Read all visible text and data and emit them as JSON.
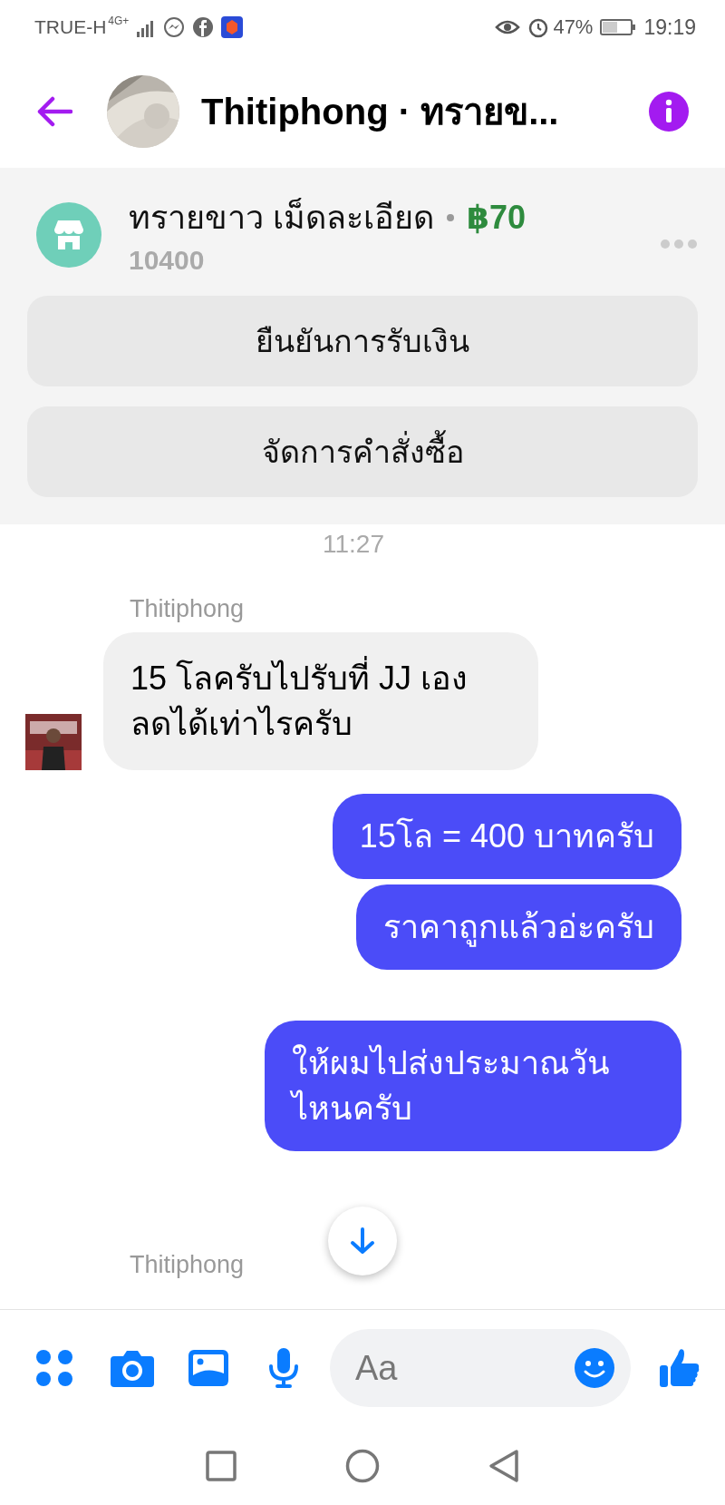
{
  "status_bar": {
    "carrier": "TRUE-H",
    "network": "4G+",
    "battery": "47%",
    "time": "19:19"
  },
  "header": {
    "title": "Thitiphong · ทรายข..."
  },
  "listing": {
    "title": "ทรายขาว เม็ดละเอียด",
    "price": "฿70",
    "code": "10400",
    "actions": [
      "ยืนยันการรับเงิน",
      "จัดการคำสั่งซื้อ"
    ]
  },
  "messages": [
    {
      "kind": "timestamp",
      "text": "11:27"
    },
    {
      "kind": "sender",
      "text": "Thitiphong"
    },
    {
      "kind": "incoming",
      "text": "15 โลครับไปรับที่ JJ เอง ลดได้เท่าไรครับ"
    },
    {
      "kind": "outgoing",
      "text": "15โล = 400 บาทครับ"
    },
    {
      "kind": "outgoing",
      "text": "ราคาถูกแล้วอ่ะครับ"
    },
    {
      "kind": "outgoing",
      "text": "ให้ผมไปส่งประมาณวันไหนครับ"
    },
    {
      "kind": "sender",
      "text": "Thitiphong"
    }
  ],
  "composer": {
    "placeholder": "Aa"
  }
}
